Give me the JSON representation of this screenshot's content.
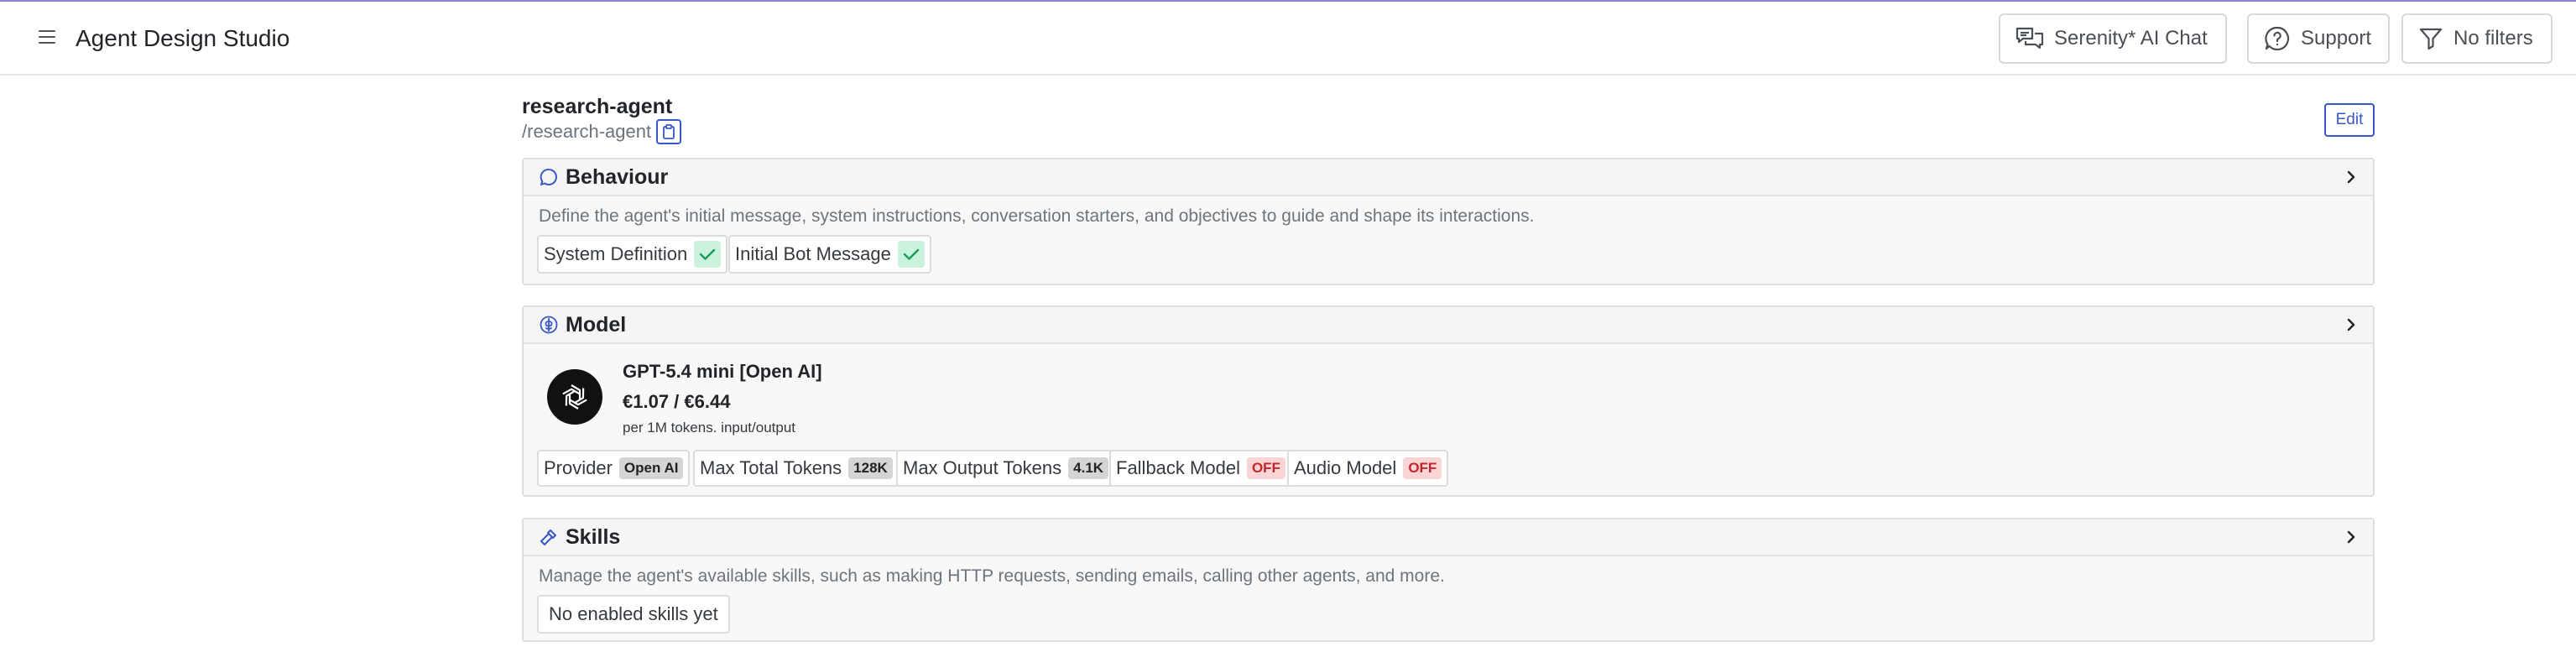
{
  "app": {
    "title": "Agent Design Studio"
  },
  "topbar": {
    "chat_label": "Serenity* AI Chat",
    "support_label": "Support",
    "filters_label": "No filters"
  },
  "agent": {
    "name": "research-agent",
    "slug": "/research-agent",
    "edit_label": "Edit"
  },
  "behaviour": {
    "title": "Behaviour",
    "description": "Define the agent's initial message, system instructions, conversation starters, and objectives to guide and shape its interactions.",
    "items": [
      "System Definition",
      "Initial Bot Message"
    ]
  },
  "model": {
    "title": "Model",
    "name": "GPT-5.4 mini [Open AI]",
    "price": "€1.07 / €6.44",
    "unit": "per 1M tokens. input/output",
    "specs": [
      {
        "label": "Provider",
        "value": "Open AI",
        "style": "gray"
      },
      {
        "label": "Max Total Tokens",
        "value": "128K",
        "style": "gray"
      },
      {
        "label": "Max Output Tokens",
        "value": "4.1K",
        "style": "gray"
      },
      {
        "label": "Fallback Model",
        "value": "OFF",
        "style": "off"
      },
      {
        "label": "Audio Model",
        "value": "OFF",
        "style": "off"
      }
    ]
  },
  "skills": {
    "title": "Skills",
    "description": "Manage the agent's available skills, such as making HTTP requests, sending emails, calling other agents, and more.",
    "empty_label": "No enabled skills yet"
  },
  "colors": {
    "accent": "#3a57c9",
    "success_bg": "#c9f3dc",
    "danger": "#c0262d",
    "danger_bg": "#fbd5d5"
  },
  "icons": {
    "menu": "hamburger-icon",
    "chat": "chat-bubbles-icon",
    "support": "question-circle-icon",
    "filter": "funnel-icon",
    "copy": "clipboard-icon",
    "behaviour": "speech-bubble-icon",
    "model": "brain-icon",
    "skills": "hammer-icon",
    "expand": "chevron-right-icon",
    "check": "checkmark-icon",
    "provider_logo": "openai-logo-icon"
  }
}
